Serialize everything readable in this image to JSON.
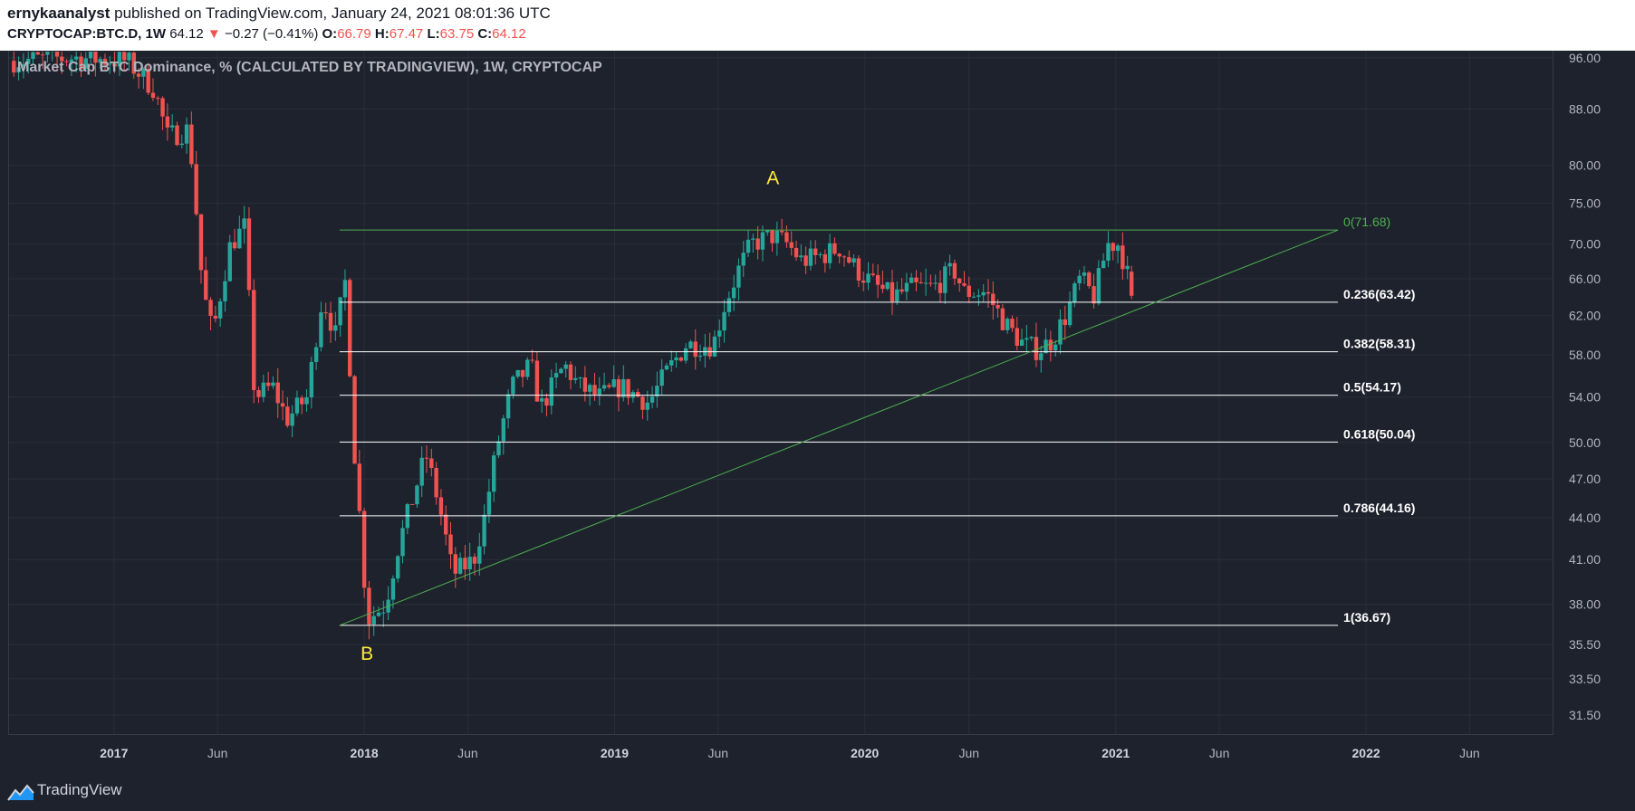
{
  "header": {
    "username": "ernykaanalyst",
    "published_text": "published on TradingView.com, January 24, 2021 08:01:36 UTC",
    "symbol": "CRYPTOCAP:BTC.D, 1W",
    "last": "64.12",
    "change_arrow": "▼",
    "change": "−0.27 (−0.41%)",
    "open_label": "O:",
    "open": "66.79",
    "high_label": "H:",
    "high": "67.47",
    "low_label": "L:",
    "low": "63.75",
    "close_label": "C:",
    "close": "64.12"
  },
  "chart_title": "Market Cap BTC Dominance, % (CALCULATED BY TRADINGVIEW), 1W, CRYPTOCAP",
  "footer": {
    "brand": "TradingView",
    "logo_icon": "tradingview-logo-icon"
  },
  "colors": {
    "background": "#1e222d",
    "up": "#26a69a",
    "down": "#ef5350",
    "fib_line": "#ffffff",
    "fib_top": "#4caf50",
    "trendline": "#4caf50",
    "wave_label": "#ffeb3b",
    "grid": "#2a2e39",
    "axis_text": "#b2b5be"
  },
  "chart_data": {
    "type": "candlestick",
    "title": "Market Cap BTC Dominance, % (CALCULATED BY TRADINGVIEW), 1W, CRYPTOCAP",
    "scale": "log",
    "ylim": [
      30.5,
      97
    ],
    "xlim": [
      "2016-08-01",
      "2022-09-30"
    ],
    "grid": true,
    "y_ticks": [
      "96.00",
      "88.00",
      "80.00",
      "75.00",
      "70.00",
      "66.00",
      "62.00",
      "58.00",
      "54.00",
      "50.00",
      "47.00",
      "44.00",
      "41.00",
      "38.00",
      "35.50",
      "33.50",
      "31.50"
    ],
    "x_ticks": [
      {
        "label": "2017",
        "date": "2017-01-01"
      },
      {
        "label": "Jun",
        "date": "2017-06-01"
      },
      {
        "label": "2018",
        "date": "2018-01-01"
      },
      {
        "label": "Jun",
        "date": "2018-06-01"
      },
      {
        "label": "2019",
        "date": "2019-01-01"
      },
      {
        "label": "Jun",
        "date": "2019-06-01"
      },
      {
        "label": "2020",
        "date": "2020-01-01"
      },
      {
        "label": "Jun",
        "date": "2020-06-01"
      },
      {
        "label": "2021",
        "date": "2021-01-01"
      },
      {
        "label": "Jun",
        "date": "2021-06-01"
      },
      {
        "label": "2022",
        "date": "2022-01-01"
      },
      {
        "label": "Jun",
        "date": "2022-06-01"
      }
    ],
    "price_path": [
      [
        "2016-08-01",
        95.5
      ],
      [
        "2016-11-01",
        96
      ],
      [
        "2017-01-20",
        95.5
      ],
      [
        "2017-03-01",
        91
      ],
      [
        "2017-03-20",
        84
      ],
      [
        "2017-04-20",
        85
      ],
      [
        "2017-05-10",
        65
      ],
      [
        "2017-05-25",
        60
      ],
      [
        "2017-06-20",
        70
      ],
      [
        "2017-07-10",
        72
      ],
      [
        "2017-07-25",
        54
      ],
      [
        "2017-08-20",
        55
      ],
      [
        "2017-09-10",
        52
      ],
      [
        "2017-10-10",
        54
      ],
      [
        "2017-11-01",
        64
      ],
      [
        "2017-11-20",
        60
      ],
      [
        "2017-12-05",
        66
      ],
      [
        "2017-12-15",
        51
      ],
      [
        "2018-01-05",
        37
      ],
      [
        "2018-02-01",
        38
      ],
      [
        "2018-02-20",
        42
      ],
      [
        "2018-03-10",
        45
      ],
      [
        "2018-04-01",
        49
      ],
      [
        "2018-04-20",
        45
      ],
      [
        "2018-05-10",
        40
      ],
      [
        "2018-06-10",
        41
      ],
      [
        "2018-06-25",
        44
      ],
      [
        "2018-07-15",
        50
      ],
      [
        "2018-08-05",
        55
      ],
      [
        "2018-09-01",
        57
      ],
      [
        "2018-09-15",
        53
      ],
      [
        "2018-10-20",
        57
      ],
      [
        "2018-11-10",
        55
      ],
      [
        "2018-12-10",
        54
      ],
      [
        "2019-01-10",
        55
      ],
      [
        "2019-02-20",
        53.5
      ],
      [
        "2019-03-15",
        56
      ],
      [
        "2019-04-15",
        59
      ],
      [
        "2019-05-10",
        59
      ],
      [
        "2019-05-25",
        59
      ],
      [
        "2019-06-10",
        63
      ],
      [
        "2019-07-01",
        67
      ],
      [
        "2019-07-20",
        70
      ],
      [
        "2019-08-20",
        71
      ],
      [
        "2019-09-10",
        70
      ],
      [
        "2019-10-01",
        68
      ],
      [
        "2019-10-25",
        68.5
      ],
      [
        "2019-11-25",
        69.5
      ],
      [
        "2019-12-20",
        67
      ],
      [
        "2020-01-20",
        65
      ],
      [
        "2020-02-10",
        64
      ],
      [
        "2020-03-10",
        65
      ],
      [
        "2020-04-10",
        65
      ],
      [
        "2020-05-10",
        67
      ],
      [
        "2020-05-25",
        64.5
      ],
      [
        "2020-06-25",
        64.5
      ],
      [
        "2020-07-25",
        61
      ],
      [
        "2020-08-20",
        59
      ],
      [
        "2020-09-10",
        58.5
      ],
      [
        "2020-10-01",
        59.5
      ],
      [
        "2020-10-20",
        62
      ],
      [
        "2020-11-10",
        66
      ],
      [
        "2020-12-01",
        64
      ],
      [
        "2020-12-20",
        70
      ],
      [
        "2021-01-05",
        70
      ],
      [
        "2021-01-17",
        66.8
      ],
      [
        "2021-01-24",
        64.12
      ]
    ],
    "fibonacci": [
      {
        "level": "0",
        "price": 71.68,
        "label": "0(71.68)"
      },
      {
        "level": "0.236",
        "price": 63.42,
        "label": "0.236(63.42)"
      },
      {
        "level": "0.382",
        "price": 58.31,
        "label": "0.382(58.31)"
      },
      {
        "level": "0.5",
        "price": 54.17,
        "label": "0.5(54.17)"
      },
      {
        "level": "0.618",
        "price": 50.04,
        "label": "0.618(50.04)"
      },
      {
        "level": "0.786",
        "price": 44.16,
        "label": "0.786(44.16)"
      },
      {
        "level": "1",
        "price": 36.67,
        "label": "1(36.67)"
      }
    ],
    "fib_range": {
      "start": "2017-11-26",
      "end": "2021-11-21"
    },
    "trendline": {
      "start_date": "2017-11-26",
      "start_price": 36.67,
      "end_date": "2021-11-21",
      "end_price": 71.68
    },
    "annotations": [
      {
        "text": "A",
        "date": "2019-08-20",
        "price": 77.5
      },
      {
        "text": "B",
        "date": "2018-01-05",
        "price": 34.6
      }
    ]
  }
}
